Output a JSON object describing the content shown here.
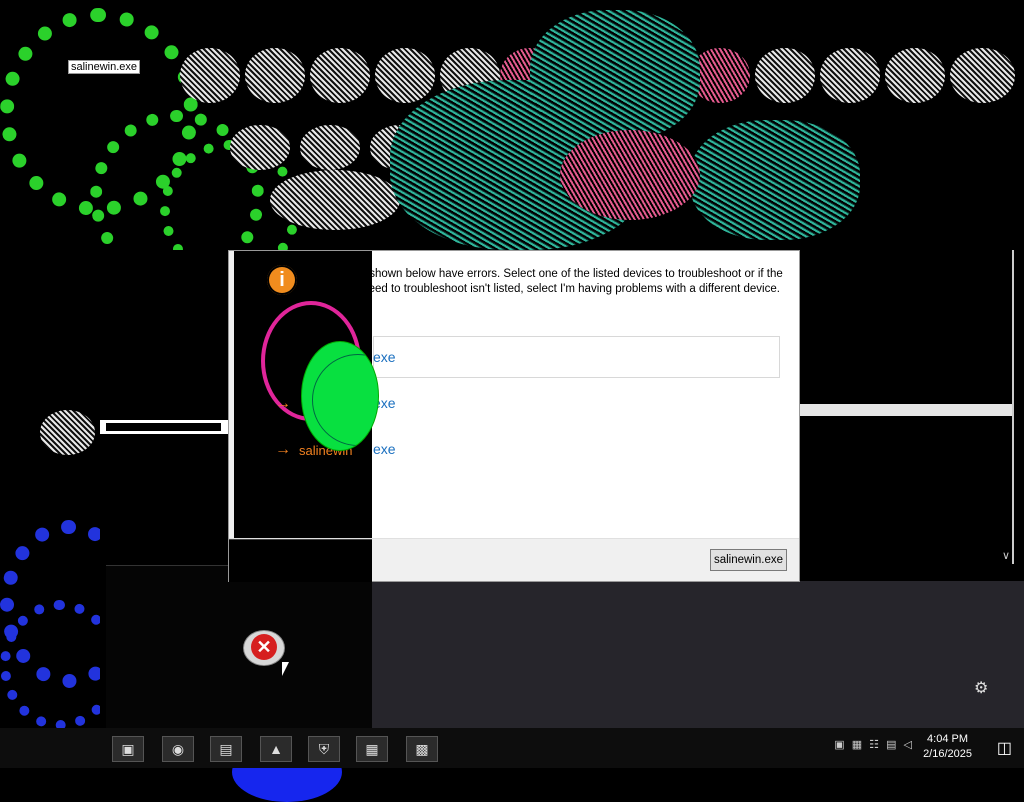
{
  "desktop": {
    "icon_label": "salinewin.exe"
  },
  "dialog": {
    "info_icon": "info-icon",
    "description": "The devices shown below have errors. Select one of the listed devices to troubleshoot or if the device you need to troubleshoot isn't listed, select I'm having problems with a different device.",
    "devices": [
      {
        "label": "exe"
      },
      {
        "label": "exe"
      },
      {
        "label": "exe"
      }
    ],
    "orange_label": "salinewin",
    "footer_button": "salinewin.exe"
  },
  "taskbar": {
    "apps": [
      "file-explorer",
      "browser",
      "screen-capture",
      "folder",
      "security",
      "window-manager",
      "photos"
    ],
    "tray_icons": "▣ ▦ ☷ ▤ ◁",
    "time": "4:04 PM",
    "date": "2/16/2025",
    "notification_icon": "notification-icon"
  },
  "colors": {
    "link": "#1a6fbf",
    "accent_orange": "#f08020",
    "error_red": "#d61f1f"
  }
}
